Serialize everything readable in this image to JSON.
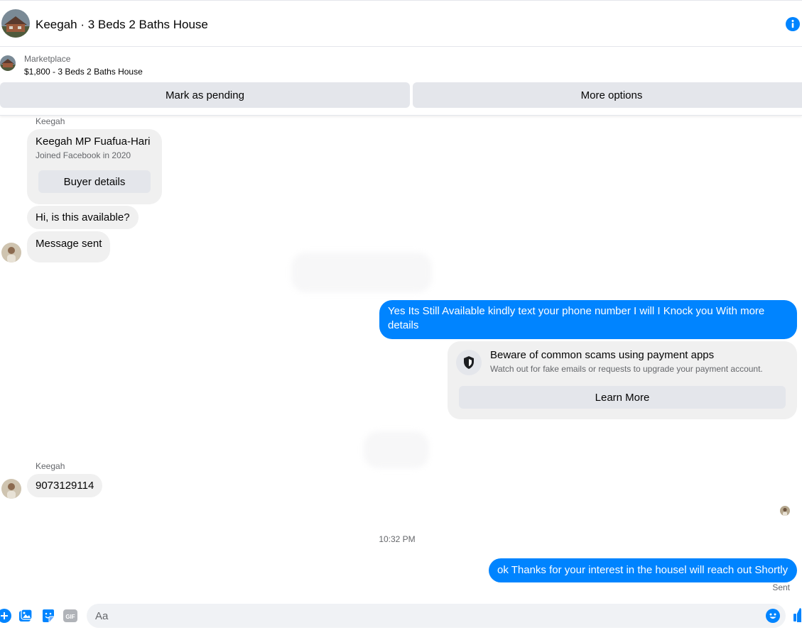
{
  "header": {
    "title": "Keegah · 3 Beds 2 Baths House",
    "info_icon": "info-icon"
  },
  "marketplace": {
    "label": "Marketplace",
    "listing": "$1,800 - 3 Beds 2 Baths House",
    "mark_pending_label": "Mark as pending",
    "more_options_label": "More options"
  },
  "buyer_card": {
    "sender": "Keegah",
    "name": "Keegah MP Fuafua-Hari",
    "joined": "Joined Facebook in 2020",
    "button_label": "Buyer details"
  },
  "messages": {
    "incoming_1": "Hi, is this available?",
    "incoming_2": "Message sent",
    "outgoing_1": "Yes Its Still Available kindly text your phone number I will I Knock you With more details",
    "sender_2": "Keegah",
    "incoming_3": "9073129114",
    "timestamp": "10:32 PM",
    "outgoing_2": "ok Thanks for your interest in the housel will reach out Shortly",
    "status": "Sent"
  },
  "scam_warning": {
    "title": "Beware of common scams using payment apps",
    "subtitle": "Watch out for fake emails or requests to upgrade your payment account.",
    "button_label": "Learn More"
  },
  "composer": {
    "placeholder": "Aa",
    "icons": [
      "plus-icon",
      "photo-icon",
      "sticker-icon",
      "gif-icon",
      "emoji-icon",
      "like-icon"
    ],
    "gif_label": "GIF"
  },
  "colors": {
    "accent": "#0084ff",
    "bubble_in": "#f0f0f0",
    "button_gray": "#e4e6eb"
  }
}
